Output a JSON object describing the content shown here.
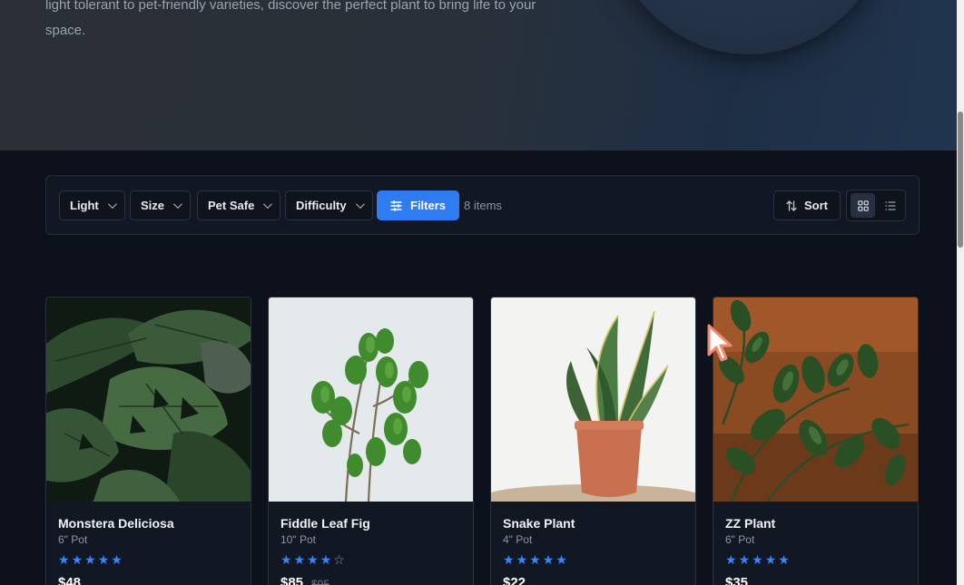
{
  "hero": {
    "text": "light tolerant to pet-friendly varieties, discover the perfect plant to bring life to your space."
  },
  "filters": {
    "light": "Light",
    "size": "Size",
    "pet_safe": "Pet Safe",
    "difficulty": "Difficulty",
    "filters_button": "Filters",
    "count": "8 items",
    "sort": "Sort"
  },
  "colors": {
    "accent": "#2f7bf2",
    "star": "#3a86f4"
  },
  "products": [
    {
      "name": "Monstera Deliciosa",
      "size": "6\" Pot",
      "rating": 5,
      "price": "$48",
      "old_price": ""
    },
    {
      "name": "Fiddle Leaf Fig",
      "size": "10\" Pot",
      "rating": 4,
      "price": "$85",
      "old_price": "$95"
    },
    {
      "name": "Snake Plant",
      "size": "4\" Pot",
      "rating": 5,
      "price": "$22",
      "old_price": ""
    },
    {
      "name": "ZZ Plant",
      "size": "6\" Pot",
      "rating": 5,
      "price": "$35",
      "old_price": ""
    }
  ]
}
